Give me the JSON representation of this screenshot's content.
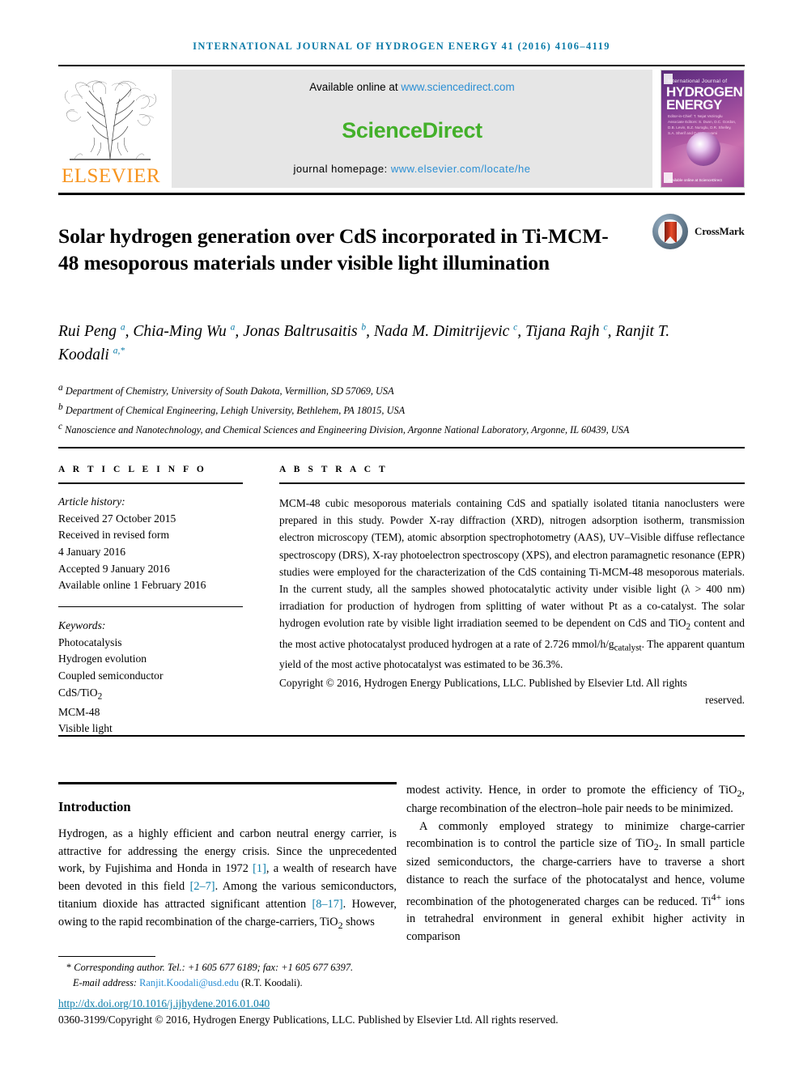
{
  "running_head": "International Journal of Hydrogen Energy 41 (2016) 4106–4119",
  "masthead": {
    "elsevier_wordmark": "ELSEVIER",
    "available_prefix": "Available online at ",
    "sciencedirect_url": "www.sciencedirect.com",
    "sciencedirect_wordmark": "ScienceDirect",
    "homepage_prefix": "journal homepage: ",
    "homepage_url": "www.elsevier.com/locate/he",
    "cover": {
      "kicker": "International Journal of",
      "line1": "HYDROGEN",
      "line2": "ENERGY",
      "meta": "Editor-in-Chief: T. Nejat Veziroglu   Associate Editors: S. Dunn, D.C. Gordon, D.B. Levin, B.Z. Nuroglu, D.R. Shelley, S.A. Sherif and D.Y. Goswami",
      "footer": "Available online at ScienceDirect"
    }
  },
  "crossmark": {
    "label": "CrossMark"
  },
  "title": "Solar hydrogen generation over CdS incorporated in Ti-MCM-48 mesoporous materials under visible light illumination",
  "authors_html": "Rui Peng <sup>a</sup>, Chia-Ming Wu <sup>a</sup>, Jonas Baltrusaitis <sup>b</sup>, Nada M. Dimitrijevic <sup>c</sup>, Tijana Rajh <sup>c</sup>, Ranjit T. Koodali <sup>a,*</sup>",
  "affiliations_html": "<sup>a</sup> Department of Chemistry, University of South Dakota, Vermillion, SD 57069, USA<br><sup>b</sup> Department of Chemical Engineering, Lehigh University, Bethlehem, PA 18015, USA<br><sup>c</sup> Nanoscience and Nanotechnology, and Chemical Sciences and Engineering Division, Argonne National Laboratory, Argonne, IL 60439, USA",
  "article_info": {
    "heading": "A R T I C L E  I N F O",
    "history_label": "Article history:",
    "history": [
      "Received 27 October 2015",
      "Received in revised form",
      "4 January 2016",
      "Accepted 9 January 2016",
      "Available online 1 February 2016"
    ],
    "keywords_label": "Keywords:",
    "keywords_html": "Photocatalysis<br>Hydrogen evolution<br>Coupled semiconductor<br>CdS/TiO<sub>2</sub><br>MCM-48<br>Visible light"
  },
  "abstract": {
    "heading": "A B S T R A C T",
    "body_html": "MCM-48 cubic mesoporous materials containing CdS and spatially isolated titania nanoclusters were prepared in this study. Powder X-ray diffraction (XRD), nitrogen adsorption isotherm, transmission electron microscopy (TEM), atomic absorption spectrophotometry (AAS), UV&ndash;Visible diffuse reflectance spectroscopy (DRS), X-ray photoelectron spectroscopy (XPS), and electron paramagnetic resonance (EPR) studies were employed for the characterization of the CdS containing Ti-MCM-48 mesoporous materials. In the current study, all the samples showed photocatalytic activity under visible light (&lambda; &gt; 400 nm) irradiation for production of hydrogen from splitting of water without Pt as a co-catalyst. The solar hydrogen evolution rate by visible light irradiation seemed to be dependent on CdS and TiO<sub>2</sub> content and the most active photocatalyst produced hydrogen at a rate of 2.726 mmol/h/g<sub>catalyst</sub>. The apparent quantum yield of the most active photocatalyst was estimated to be 36.3%.",
    "copyright_html": "Copyright &copy; 2016, Hydrogen Energy Publications, LLC. Published by Elsevier Ltd. All rights <span class=\"last\">reserved.</span>"
  },
  "body": {
    "intro_heading": "Introduction",
    "left_paragraph_html": "Hydrogen, as a highly efficient and carbon neutral energy carrier, is attractive for addressing the energy crisis. Since the unprecedented work, by Fujishima and Honda in 1972 <span class=\"ref\">[1]</span>, a wealth of research have been devoted in this field <span class=\"ref\">[2&ndash;7]</span>. Among the various semiconductors, titanium dioxide has attracted significant attention <span class=\"ref\">[8&ndash;17]</span>. However, owing to the rapid recombination of the charge-carriers, TiO<sub>2</sub> shows",
    "right_paragraph_1_html": "modest activity. Hence, in order to promote the efficiency of TiO<sub>2</sub>, charge recombination of the electron&ndash;hole pair needs to be minimized.",
    "right_paragraph_2_html": "A commonly employed strategy to minimize charge-carrier recombination is to control the particle size of TiO<sub>2</sub>. In small particle sized semiconductors, the charge-carriers have to traverse a short distance to reach the surface of the photocatalyst and hence, volume recombination of the photogenerated charges can be reduced. Ti<sup>4+</sup> ions in tetrahedral environment in general exhibit higher activity in comparison"
  },
  "footer": {
    "corresponding_html": "<span style=\"font-style:normal\">*</span> Corresponding author. Tel.: +1 605 677 6189; fax: +1 605 677 6397.",
    "email_label": "E-mail address: ",
    "email": "Ranjit.Koodali@usd.edu",
    "email_suffix": " (R.T. Koodali).",
    "doi": "http://dx.doi.org/10.1016/j.ijhydene.2016.01.040",
    "issn_line": "0360-3199/Copyright © 2016, Hydrogen Energy Publications, LLC. Published by Elsevier Ltd. All rights reserved."
  },
  "colors": {
    "link": "#0b7ba8",
    "sciencedirect_green": "#43b02a",
    "elsevier_orange": "#F7941E",
    "band_gray": "#e6e6e6"
  }
}
